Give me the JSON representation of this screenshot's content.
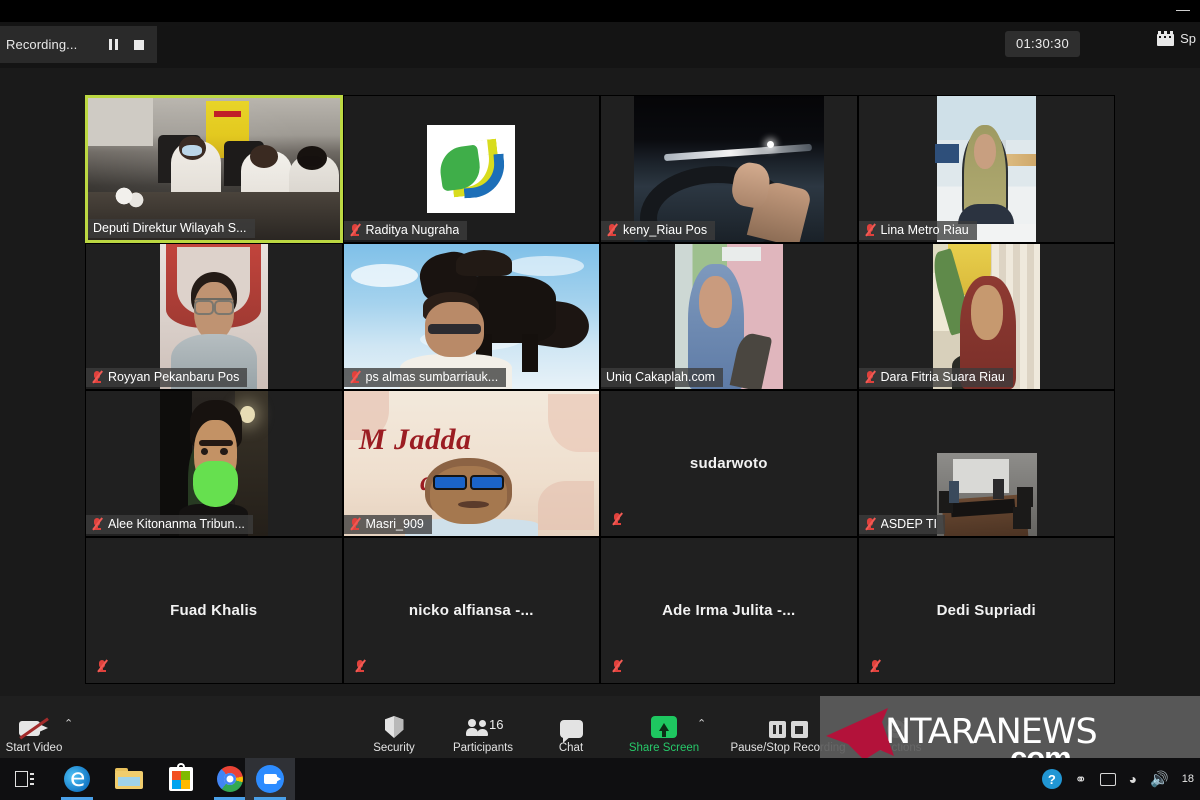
{
  "window": {
    "minimize_icon": "minimize-icon"
  },
  "header": {
    "recording_label": "Recording...",
    "pause_icon": "pause-icon",
    "stop_icon": "stop-icon",
    "timer": "01:30:30",
    "view_label": "Sp",
    "calendar_icon": "calendar-icon"
  },
  "gallery": {
    "rows": [
      [
        {
          "name": "Deputi Direktur Wilayah S...",
          "muted": false,
          "active_speaker": true,
          "video": true,
          "label_style": "overlay"
        },
        {
          "name": "Raditya Nugraha",
          "muted": true,
          "active_speaker": false,
          "video": true,
          "label_style": "overlay"
        },
        {
          "name": "keny_Riau Pos",
          "muted": true,
          "active_speaker": false,
          "video": true,
          "label_style": "overlay"
        },
        {
          "name": "Lina Metro Riau",
          "muted": true,
          "active_speaker": false,
          "video": true,
          "label_style": "overlay"
        }
      ],
      [
        {
          "name": "Royyan Pekanbaru Pos",
          "muted": true,
          "active_speaker": false,
          "video": true,
          "label_style": "overlay"
        },
        {
          "name": "ps almas sumbarriauk...",
          "muted": true,
          "active_speaker": false,
          "video": true,
          "label_style": "overlay"
        },
        {
          "name": "Uniq Cakaplah.com",
          "muted": false,
          "active_speaker": false,
          "video": true,
          "label_style": "overlay"
        },
        {
          "name": "Dara Fitria Suara Riau",
          "muted": true,
          "active_speaker": false,
          "video": true,
          "label_style": "overlay"
        }
      ],
      [
        {
          "name": "Alee Kitonanma Tribun...",
          "muted": true,
          "active_speaker": false,
          "video": true,
          "label_style": "overlay"
        },
        {
          "name": "Masri_909",
          "muted": true,
          "active_speaker": false,
          "video": true,
          "label_style": "overlay"
        },
        {
          "name": "sudarwoto",
          "muted": true,
          "active_speaker": false,
          "video": false,
          "label_style": "center"
        },
        {
          "name": "ASDEP TI",
          "muted": true,
          "active_speaker": false,
          "video": true,
          "label_style": "overlay"
        }
      ],
      [
        {
          "name": "Fuad Khalis",
          "muted": true,
          "active_speaker": false,
          "video": false,
          "label_style": "center"
        },
        {
          "name": "nicko alfiansa -...",
          "muted": true,
          "active_speaker": false,
          "video": false,
          "label_style": "center"
        },
        {
          "name": "Ade Irma Julita -...",
          "muted": true,
          "active_speaker": false,
          "video": false,
          "label_style": "center"
        },
        {
          "name": "Dedi Supriadi",
          "muted": true,
          "active_speaker": false,
          "video": false,
          "label_style": "center"
        }
      ]
    ]
  },
  "tile_art": {
    "masri_bg_line1": "M    Jadda",
    "masri_bg_line2": "ada"
  },
  "toolbar": {
    "start_video": {
      "label": "Start Video",
      "icon": "camera-off-icon",
      "caret": "⌃"
    },
    "security": {
      "label": "Security",
      "icon": "shield-icon"
    },
    "participants": {
      "label": "Participants",
      "icon": "people-icon",
      "count": "16"
    },
    "chat": {
      "label": "Chat",
      "icon": "chat-bubble-icon"
    },
    "share_screen": {
      "label": "Share Screen",
      "icon": "share-up-arrow-icon",
      "caret": "⌃",
      "color": "#1ec760"
    },
    "recording": {
      "label": "Pause/Stop Recording",
      "pause_icon": "pause-icon",
      "stop_icon": "stop-icon"
    },
    "reactions": {
      "label": "Reactions",
      "icon": "smiley-plus-icon"
    }
  },
  "watermark": {
    "brand": "ANTARANEWS",
    "suffix": "com",
    "arrow_icon": "arrow-pointer-icon",
    "arrow_color": "#b3123a"
  },
  "taskbar": {
    "items": [
      {
        "name": "task-view",
        "icon": "task-view-icon",
        "active": false
      },
      {
        "name": "edge",
        "icon": "edge-browser-icon",
        "active": false
      },
      {
        "name": "file-explorer",
        "icon": "folder-icon",
        "active": false
      },
      {
        "name": "microsoft-store",
        "icon": "store-bag-icon",
        "active": false
      },
      {
        "name": "chrome",
        "icon": "chrome-browser-icon",
        "active": false
      },
      {
        "name": "zoom",
        "icon": "zoom-camera-icon",
        "active": true
      }
    ],
    "tray": {
      "help": "?",
      "people_icon": "people-share-icon",
      "monitor_icon": "monitor-icon",
      "wifi_icon": "wifi-icon",
      "speaker_icon": "speaker-mute-icon",
      "clock": "18"
    }
  }
}
